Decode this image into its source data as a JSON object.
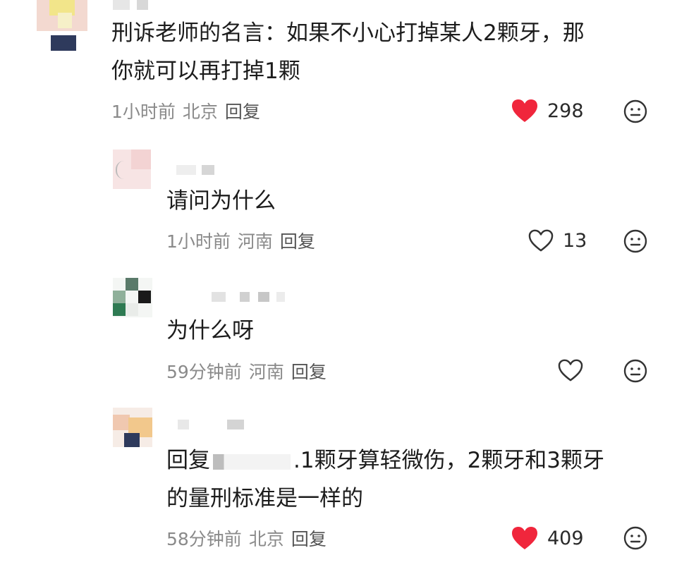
{
  "colors": {
    "liked": "#f0263c",
    "meta": "#8a8a8a",
    "text": "#1c1c1c"
  },
  "comments": [
    {
      "text_lines": [
        "刑诉老师的名言：如果不小心打掉某人2颗牙，那",
        "你就可以再打掉1颗"
      ],
      "time": "1小时前",
      "location": "北京",
      "reply": "回复",
      "likes": "298",
      "liked": true
    },
    {
      "text_lines": [
        "请问为什么"
      ],
      "time": "1小时前",
      "location": "河南",
      "reply": "回复",
      "likes": "13",
      "liked": false
    },
    {
      "text_lines": [
        "为什么呀"
      ],
      "time": "59分钟前",
      "location": "河南",
      "reply": "回复",
      "likes": "",
      "liked": false
    },
    {
      "reply_prefix": "回复",
      "text_lines": [
        ".1颗牙算轻微伤，2颗牙和3颗牙",
        "的量刑标准是一样的"
      ],
      "time": "58分钟前",
      "location": "北京",
      "reply": "回复",
      "likes": "409",
      "liked": true
    }
  ],
  "icons": {
    "heart": "heart-icon",
    "dislike": "neutral-face-icon"
  }
}
